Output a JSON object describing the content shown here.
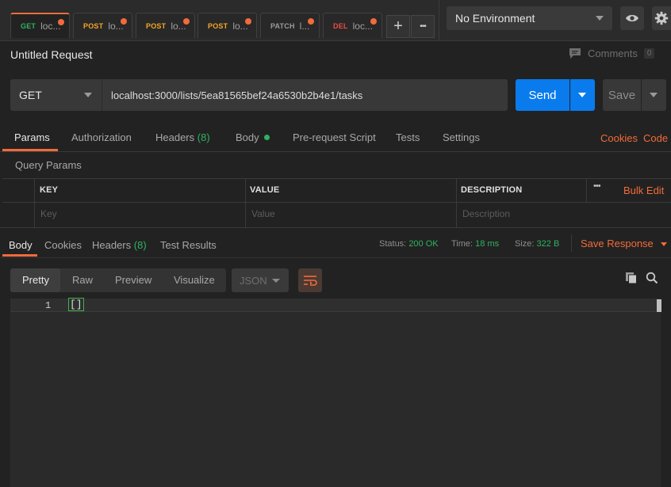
{
  "tabs": [
    {
      "method": "GET",
      "label": "loc...",
      "color": "#2eb35f",
      "active": true
    },
    {
      "method": "POST",
      "label": "lo...",
      "color": "#f5a623",
      "active": false
    },
    {
      "method": "POST",
      "label": "lo...",
      "color": "#f5a623",
      "active": false
    },
    {
      "method": "POST",
      "label": "lo...",
      "color": "#f5a623",
      "active": false
    },
    {
      "method": "PATCH",
      "label": "l...",
      "color": "#9a9a9a",
      "active": false
    },
    {
      "method": "DEL",
      "label": "loc...",
      "color": "#ec4c47",
      "active": false
    }
  ],
  "tab_controls": {
    "add": "+",
    "more": "•••"
  },
  "environment": {
    "selected": "No Environment"
  },
  "request": {
    "title": "Untitled Request",
    "comments_label": "Comments",
    "comments_count": "0",
    "method": "GET",
    "url": "localhost:3000/lists/5ea81565bef24a6530b2b4e1/tasks",
    "send_label": "Send",
    "save_label": "Save"
  },
  "request_tabs": {
    "params": "Params",
    "authorization": "Authorization",
    "headers": "Headers",
    "headers_count": "(8)",
    "body": "Body",
    "prerequest": "Pre-request Script",
    "tests": "Tests",
    "settings": "Settings",
    "cookies": "Cookies",
    "code": "Code"
  },
  "query_params": {
    "label": "Query Params",
    "columns": {
      "key": "KEY",
      "value": "VALUE",
      "description": "DESCRIPTION"
    },
    "more": "•••",
    "bulk_edit": "Bulk Edit",
    "placeholders": {
      "key": "Key",
      "value": "Value",
      "description": "Description"
    }
  },
  "response": {
    "tabs": {
      "body": "Body",
      "cookies": "Cookies",
      "headers": "Headers",
      "headers_count": "(8)",
      "test_results": "Test Results"
    },
    "status_label": "Status:",
    "status_value": "200 OK",
    "time_label": "Time:",
    "time_value": "18 ms",
    "size_label": "Size:",
    "size_value": "322 B",
    "save_response": "Save Response",
    "formats": {
      "pretty": "Pretty",
      "raw": "Raw",
      "preview": "Preview",
      "visualize": "Visualize"
    },
    "language": "JSON",
    "line_number": "1",
    "body_text": "[]"
  },
  "colors": {
    "accent": "#f26b3a",
    "primary": "#097bed",
    "success": "#2eb35f"
  }
}
